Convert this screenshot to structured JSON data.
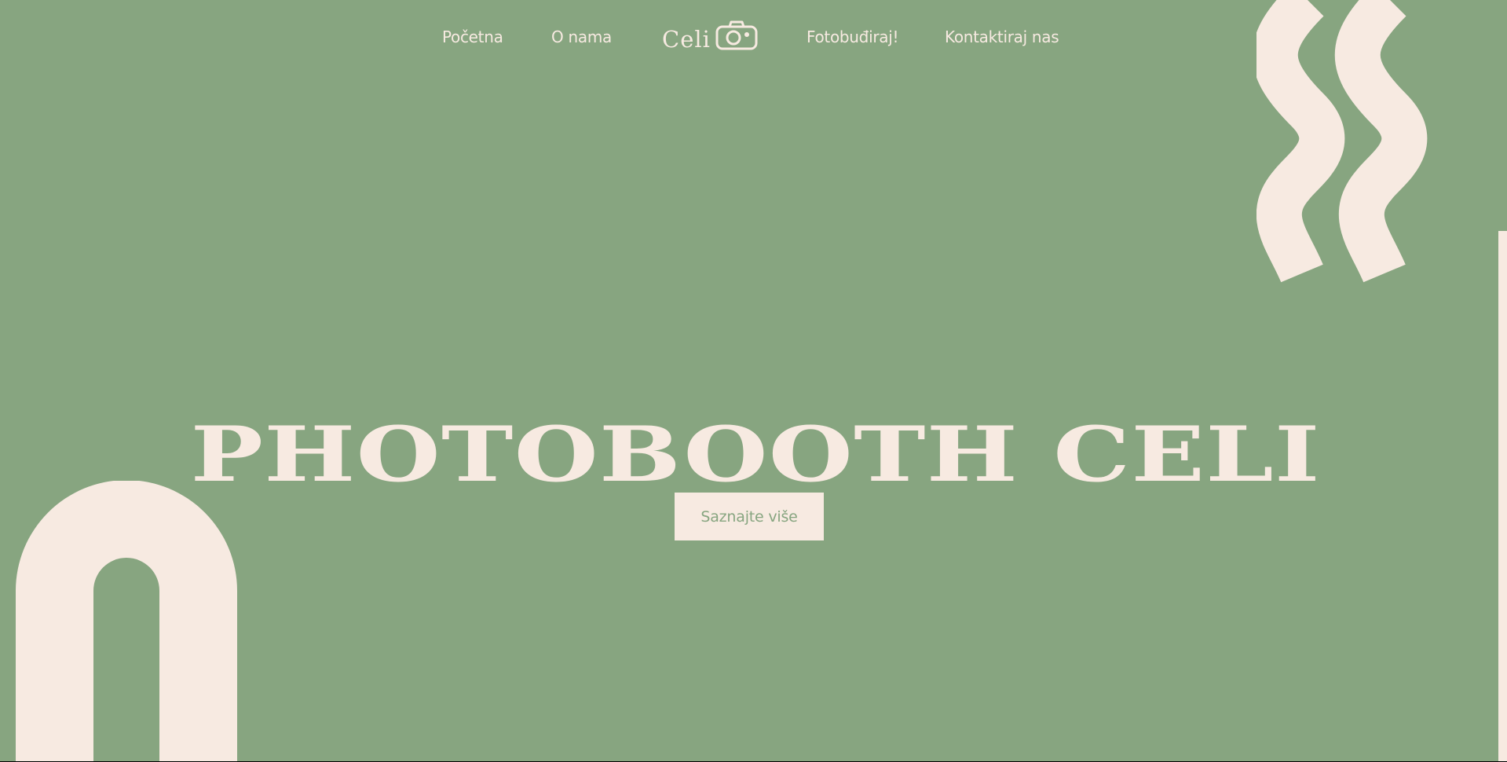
{
  "nav": {
    "items": [
      {
        "label": "Početna"
      },
      {
        "label": "O nama"
      },
      {
        "label": "Fotobuđiraj!"
      },
      {
        "label": "Kontaktiraj nas"
      }
    ],
    "logo": {
      "text": "Celi",
      "icon": "camera-icon"
    }
  },
  "hero": {
    "title": "PHOTOBOOTH CELI",
    "cta_label": "Saznajte više"
  },
  "colors": {
    "background": "#87a580",
    "cream": "#f7eae1"
  }
}
